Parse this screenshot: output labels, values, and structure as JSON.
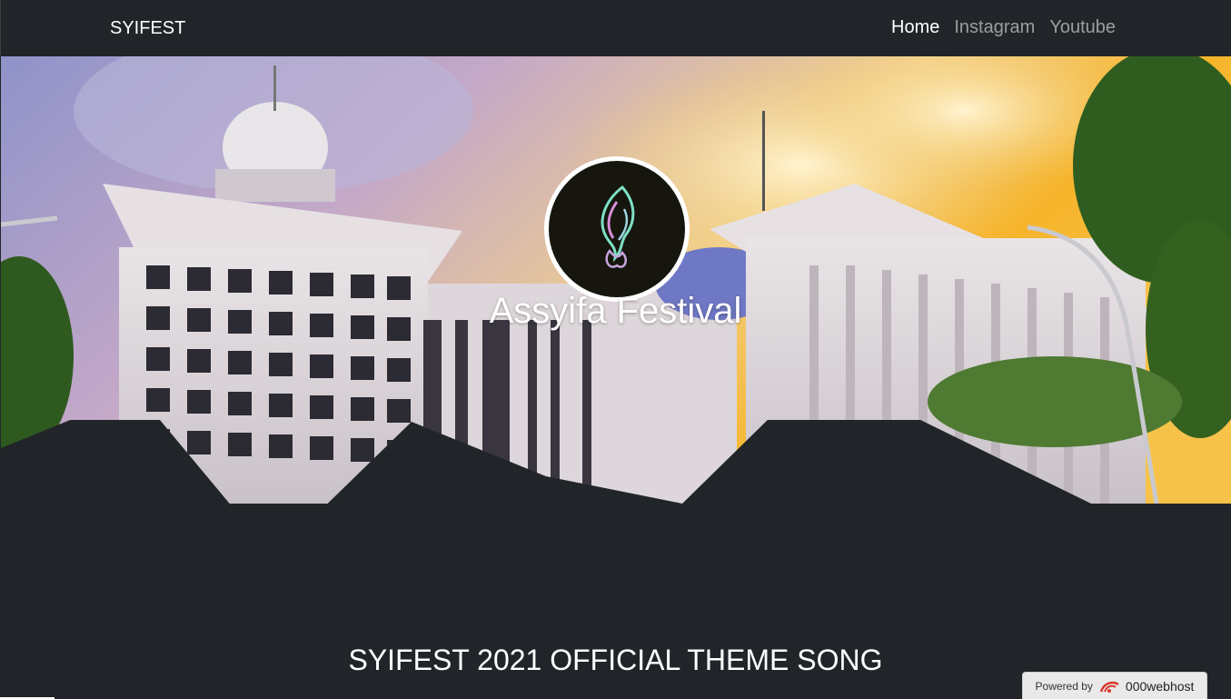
{
  "navbar": {
    "brand": "SYIFEST",
    "links": [
      {
        "label": "Home",
        "active": true
      },
      {
        "label": "Instagram",
        "active": false
      },
      {
        "label": "Youtube",
        "active": false
      }
    ]
  },
  "hero": {
    "logo_icon": "flame-logo-icon",
    "title": "Assyifa Festival"
  },
  "section": {
    "title": "SYIFEST 2021 OFFICIAL THEME SONG"
  },
  "badge": {
    "powered_by": "Powered by",
    "host": "000webhost"
  },
  "colors": {
    "background": "#212529",
    "nav_active": "#ffffff",
    "nav_inactive": "rgba(255,255,255,0.55)"
  }
}
